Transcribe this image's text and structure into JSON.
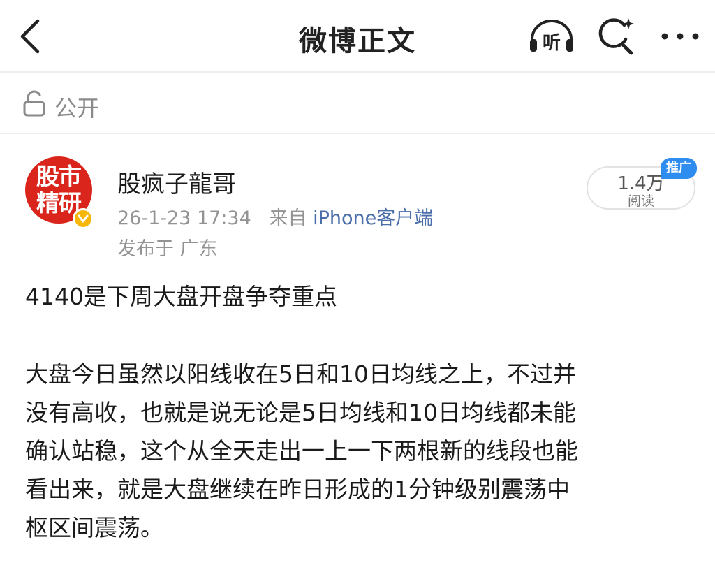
{
  "header": {
    "title": "微博正文",
    "listen_label": "听"
  },
  "visibility": {
    "label": "公开"
  },
  "author": {
    "avatar_text_line1": "股市",
    "avatar_text_line2": "精研",
    "name": "股疯子龍哥",
    "timestamp": "26-1-23 17:34",
    "source_prefix": "来自",
    "source": "iPhone客户端",
    "location": "发布于 广东"
  },
  "stats": {
    "read_count": "1.4万",
    "read_label": "阅读",
    "promo_tag": "推广"
  },
  "post": {
    "headline": "4140是下周大盘开盘争夺重点",
    "lines": [
      "大盘今日虽然以阳线收在5日和10日均线之上，不过并",
      "没有高收，也就是说无论是5日均线和10日均线都未能",
      "确认站稳，这个从全天走出一上一下两根新的线段也能",
      "看出来，就是大盘继续在昨日形成的1分钟级别震荡中",
      "枢区间震荡。"
    ]
  },
  "colors": {
    "avatar_bg": "#d9251c",
    "verified_badge": "#f6b70a",
    "link_blue": "#4a6ea9",
    "promo_blue": "#2f8df0"
  },
  "icons": [
    "back-arrow-icon",
    "headphones-icon",
    "search-sparkle-icon",
    "more-dots-icon",
    "lock-icon",
    "verified-icon"
  ]
}
